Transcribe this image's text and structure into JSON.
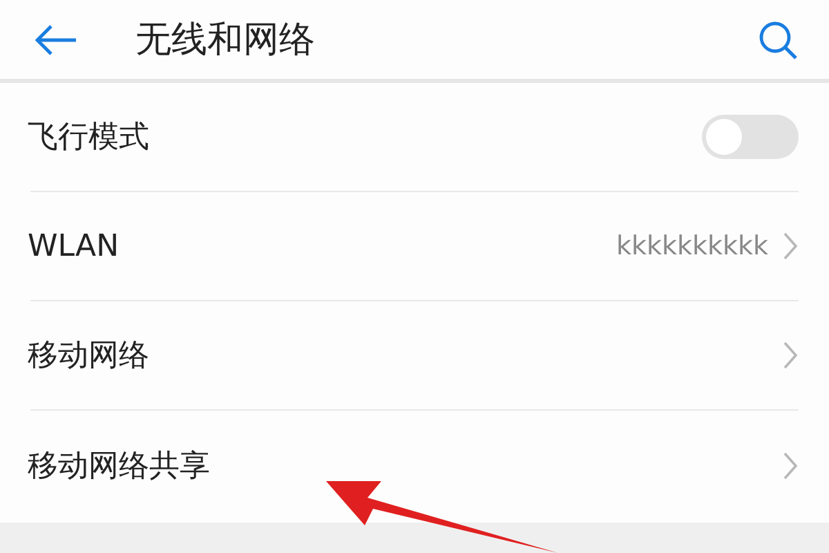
{
  "header": {
    "title": "无线和网络"
  },
  "items": [
    {
      "kind": "switch",
      "label": "飞行模式",
      "on": false
    },
    {
      "kind": "link",
      "label": "WLAN",
      "value": "kkkkkkkkkk"
    },
    {
      "kind": "link",
      "label": "移动网络"
    },
    {
      "kind": "link",
      "label": "移动网络共享"
    }
  ],
  "annotation": {
    "kind": "arrow"
  }
}
